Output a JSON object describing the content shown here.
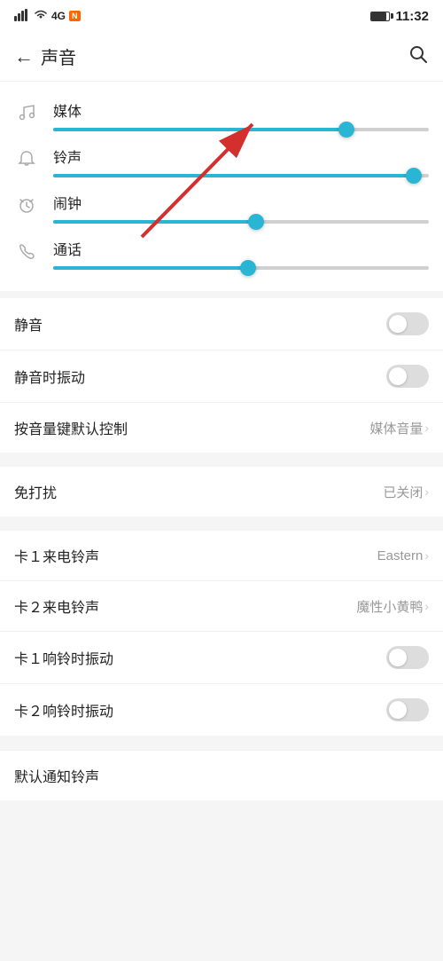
{
  "statusBar": {
    "signal": "4G",
    "time": "11:32"
  },
  "header": {
    "title": "声音",
    "backLabel": "←",
    "searchLabel": "🔍"
  },
  "sliders": [
    {
      "id": "media",
      "label": "媒体",
      "icon": "♪",
      "fillPercent": 78,
      "thumbPercent": 78
    },
    {
      "id": "ringtone",
      "label": "铃声",
      "icon": "🔔",
      "fillPercent": 96,
      "thumbPercent": 96
    },
    {
      "id": "alarm",
      "label": "闹钟",
      "icon": "⏰",
      "fillPercent": 54,
      "thumbPercent": 54
    },
    {
      "id": "call",
      "label": "通话",
      "icon": "📞",
      "fillPercent": 52,
      "thumbPercent": 52
    }
  ],
  "toggleItems": [
    {
      "id": "mute",
      "label": "静音",
      "type": "toggle",
      "on": false
    },
    {
      "id": "vibrate-mute",
      "label": "静音时振动",
      "type": "toggle",
      "on": false
    },
    {
      "id": "volume-key",
      "label": "按音量键默认控制",
      "type": "value",
      "value": "媒体音量"
    }
  ],
  "dndItem": {
    "label": "免打扰",
    "value": "已关闭"
  },
  "ringItems": [
    {
      "id": "sim1-ring",
      "label": "卡１来电铃声",
      "value": "Eastern"
    },
    {
      "id": "sim2-ring",
      "label": "卡２来电铃声",
      "value": "魔性小黄鸭"
    },
    {
      "id": "sim1-vibrate",
      "label": "卡１响铃时振动",
      "type": "toggle",
      "on": false
    },
    {
      "id": "sim2-vibrate",
      "label": "卡２响铃时振动",
      "type": "toggle",
      "on": false
    }
  ],
  "partialItem": {
    "label": "默认通知铃声"
  }
}
